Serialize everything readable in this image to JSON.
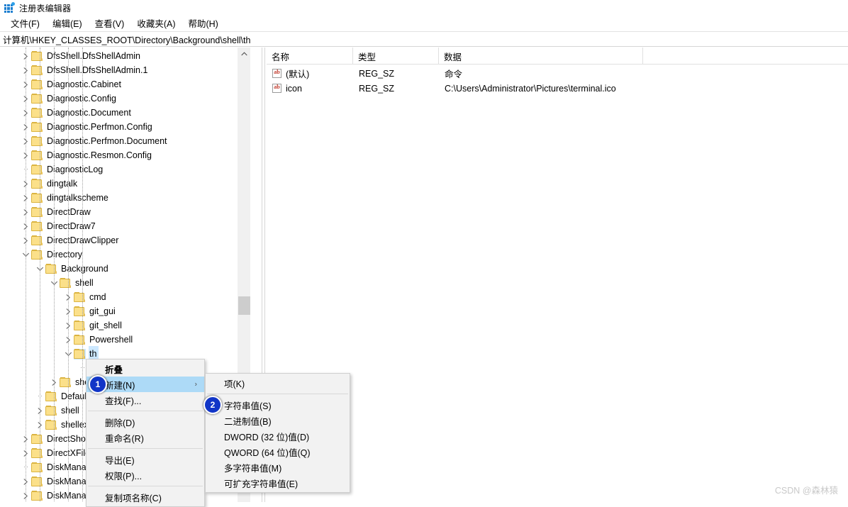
{
  "window": {
    "title": "注册表编辑器",
    "icon": "registry-grid-icon"
  },
  "menubar": {
    "items": [
      {
        "label": "文件(F)",
        "text": "文件",
        "accel": "F"
      },
      {
        "label": "编辑(E)",
        "text": "编辑",
        "accel": "E"
      },
      {
        "label": "查看(V)",
        "text": "查看",
        "accel": "V"
      },
      {
        "label": "收藏夹(A)",
        "text": "收藏夹",
        "accel": "A"
      },
      {
        "label": "帮助(H)",
        "text": "帮助",
        "accel": "H"
      }
    ]
  },
  "address": {
    "path": "计算机\\HKEY_CLASSES_ROOT\\Directory\\Background\\shell\\th"
  },
  "tree": {
    "items": [
      {
        "label": "DfsShell.DfsShellAdmin",
        "depth": 1,
        "twisty": "collapsed",
        "selected": false
      },
      {
        "label": "DfsShell.DfsShellAdmin.1",
        "depth": 1,
        "twisty": "collapsed",
        "selected": false
      },
      {
        "label": "Diagnostic.Cabinet",
        "depth": 1,
        "twisty": "collapsed",
        "selected": false
      },
      {
        "label": "Diagnostic.Config",
        "depth": 1,
        "twisty": "collapsed",
        "selected": false
      },
      {
        "label": "Diagnostic.Document",
        "depth": 1,
        "twisty": "collapsed",
        "selected": false
      },
      {
        "label": "Diagnostic.Perfmon.Config",
        "depth": 1,
        "twisty": "collapsed",
        "selected": false
      },
      {
        "label": "Diagnostic.Perfmon.Document",
        "depth": 1,
        "twisty": "collapsed",
        "selected": false
      },
      {
        "label": "Diagnostic.Resmon.Config",
        "depth": 1,
        "twisty": "collapsed",
        "selected": false
      },
      {
        "label": "DiagnosticLog",
        "depth": 1,
        "twisty": "none",
        "selected": false
      },
      {
        "label": "dingtalk",
        "depth": 1,
        "twisty": "collapsed",
        "selected": false
      },
      {
        "label": "dingtalkscheme",
        "depth": 1,
        "twisty": "collapsed",
        "selected": false
      },
      {
        "label": "DirectDraw",
        "depth": 1,
        "twisty": "collapsed",
        "selected": false
      },
      {
        "label": "DirectDraw7",
        "depth": 1,
        "twisty": "collapsed",
        "selected": false
      },
      {
        "label": "DirectDrawClipper",
        "depth": 1,
        "twisty": "collapsed",
        "selected": false
      },
      {
        "label": "Directory",
        "depth": 1,
        "twisty": "expanded",
        "selected": false
      },
      {
        "label": "Background",
        "depth": 2,
        "twisty": "expanded",
        "selected": false
      },
      {
        "label": "shell",
        "depth": 3,
        "twisty": "expanded",
        "selected": false
      },
      {
        "label": "cmd",
        "depth": 4,
        "twisty": "collapsed",
        "selected": false
      },
      {
        "label": "git_gui",
        "depth": 4,
        "twisty": "collapsed",
        "selected": false
      },
      {
        "label": "git_shell",
        "depth": 4,
        "twisty": "collapsed",
        "selected": false
      },
      {
        "label": "Powershell",
        "depth": 4,
        "twisty": "collapsed",
        "selected": false
      },
      {
        "label": "th",
        "depth": 4,
        "twisty": "expanded",
        "selected": true
      },
      {
        "label": "",
        "depth": 5,
        "twisty": "none",
        "selected": false
      },
      {
        "label": "shell",
        "depth": 3,
        "twisty": "collapsed",
        "selected": false
      },
      {
        "label": "DefaultIcon",
        "depth": 2,
        "twisty": "none",
        "selected": false
      },
      {
        "label": "shell",
        "depth": 2,
        "twisty": "collapsed",
        "selected": false
      },
      {
        "label": "shellex",
        "depth": 2,
        "twisty": "collapsed",
        "selected": false
      },
      {
        "label": "DirectShow",
        "depth": 1,
        "twisty": "collapsed",
        "selected": false
      },
      {
        "label": "DirectXFile",
        "depth": 1,
        "twisty": "collapsed",
        "selected": false
      },
      {
        "label": "DiskManagement.Cont",
        "depth": 1,
        "twisty": "none",
        "selected": false
      },
      {
        "label": "DiskManagement.Data",
        "depth": 1,
        "twisty": "collapsed",
        "selected": false
      },
      {
        "label": "DiskManagement.Snap",
        "depth": 1,
        "twisty": "collapsed",
        "selected": false
      }
    ],
    "scrollbar": {
      "up_arrow": "chevron-up-icon"
    }
  },
  "values": {
    "columns": [
      "名称",
      "类型",
      "数据"
    ],
    "rows": [
      {
        "name": "(默认)",
        "type": "REG_SZ",
        "data": "命令",
        "icon": "string-value-icon"
      },
      {
        "name": "icon",
        "type": "REG_SZ",
        "data": "C:\\Users\\Administrator\\Pictures\\terminal.ico",
        "icon": "string-value-icon"
      }
    ]
  },
  "context_menu": {
    "items": [
      {
        "label": "折叠",
        "bold": true,
        "highlight": false,
        "submenu": false,
        "separator_after": false
      },
      {
        "label": "新建(N)",
        "bold": false,
        "highlight": true,
        "submenu": true,
        "separator_after": false
      },
      {
        "label": "查找(F)...",
        "bold": false,
        "highlight": false,
        "submenu": false,
        "separator_after": true
      },
      {
        "label": "删除(D)",
        "bold": false,
        "highlight": false,
        "submenu": false,
        "separator_after": false
      },
      {
        "label": "重命名(R)",
        "bold": false,
        "highlight": false,
        "submenu": false,
        "separator_after": true
      },
      {
        "label": "导出(E)",
        "bold": false,
        "highlight": false,
        "submenu": false,
        "separator_after": false
      },
      {
        "label": "权限(P)...",
        "bold": false,
        "highlight": false,
        "submenu": false,
        "separator_after": true
      },
      {
        "label": "复制项名称(C)",
        "bold": false,
        "highlight": false,
        "submenu": false,
        "separator_after": false
      }
    ]
  },
  "context_submenu": {
    "items": [
      {
        "label": "项(K)",
        "separator_after": true
      },
      {
        "label": "字符串值(S)",
        "separator_after": false
      },
      {
        "label": "二进制值(B)",
        "separator_after": false
      },
      {
        "label": "DWORD (32 位)值(D)",
        "separator_after": false
      },
      {
        "label": "QWORD (64 位)值(Q)",
        "separator_after": false
      },
      {
        "label": "多字符串值(M)",
        "separator_after": false
      },
      {
        "label": "可扩充字符串值(E)",
        "separator_after": false
      }
    ]
  },
  "badges": [
    {
      "number": "1"
    },
    {
      "number": "2"
    }
  ],
  "watermark": {
    "text": "CSDN @森林猿"
  },
  "colors": {
    "selection": "#cce8ff",
    "menu_highlight": "#addaf7",
    "badge": "#1135c7",
    "folder": "#fbe08a",
    "folder_border": "#dbb441",
    "scroll_thumb": "#cdcdcd",
    "watermark": "#c9c9c9"
  }
}
